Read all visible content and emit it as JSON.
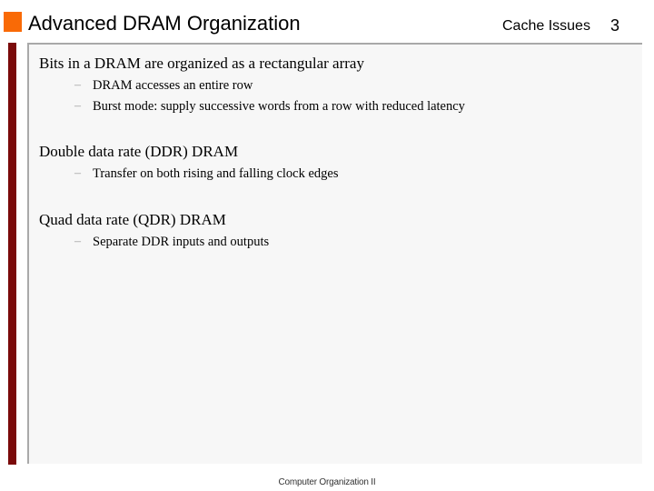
{
  "header": {
    "title": "Advanced DRAM Organization",
    "section": "Cache Issues",
    "page_number": "3",
    "accent_color": "#f96a06",
    "side_bar_color": "#7a0a0a"
  },
  "content": {
    "bullets": [
      {
        "text": "Bits in a DRAM are organized as a rectangular array",
        "sub": [
          "DRAM accesses an entire row",
          "Burst mode: supply successive words from a row with reduced latency"
        ]
      },
      {
        "text": "Double data rate (DDR) DRAM",
        "sub": [
          "Transfer on both rising and falling clock edges"
        ]
      },
      {
        "text": "Quad data rate (QDR) DRAM",
        "sub": [
          "Separate DDR inputs and outputs"
        ]
      }
    ],
    "sub_marker": "–"
  },
  "footer": {
    "text": "Computer Organization II"
  }
}
